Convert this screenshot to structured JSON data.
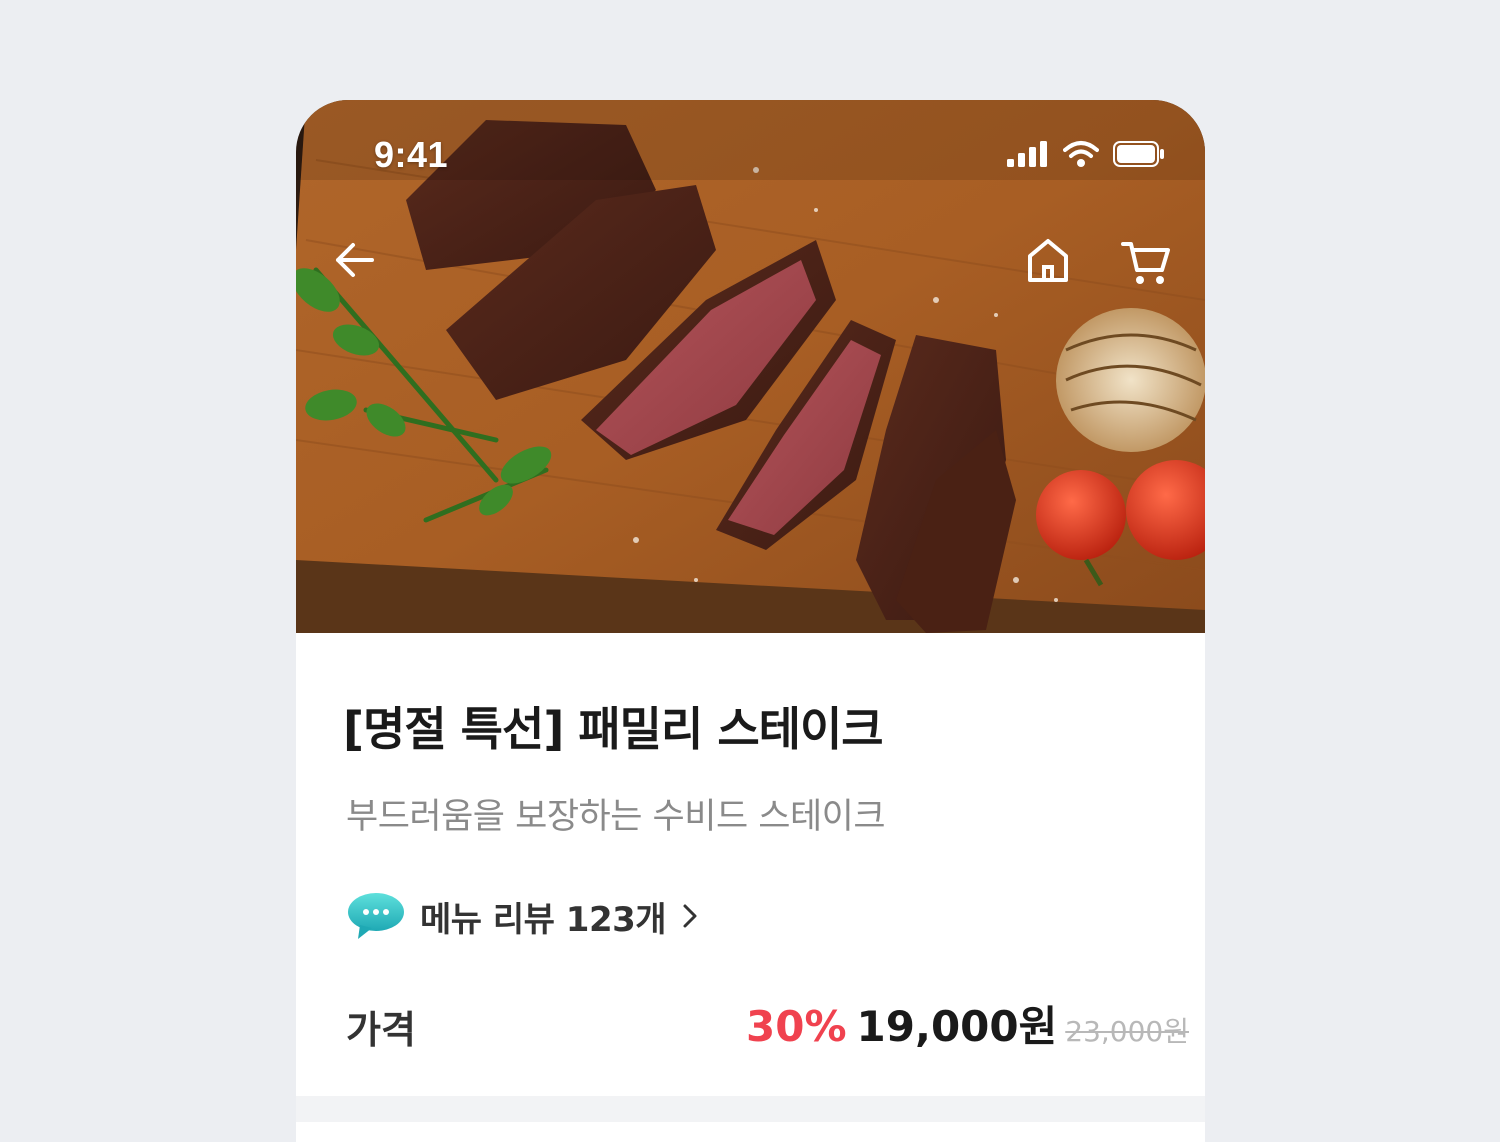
{
  "status_bar": {
    "time": "9:41",
    "icons": [
      "cellular-signal-icon",
      "wifi-icon",
      "battery-icon"
    ]
  },
  "header": {
    "icons": [
      "back-arrow-icon",
      "home-icon",
      "cart-icon"
    ]
  },
  "product": {
    "title": "[명절 특선] 패밀리 스테이크",
    "subtitle": "부드러움을 보장하는 수비드 스테이크",
    "review_label": "메뉴 리뷰 123개",
    "price_label": "가격",
    "discount_rate": "30%",
    "sale_price": "19,000원",
    "original_price": "23,000원"
  },
  "colors": {
    "discount": "#f0424f",
    "review_icon": "#2ec4c6",
    "page_background": "#eceef2"
  }
}
